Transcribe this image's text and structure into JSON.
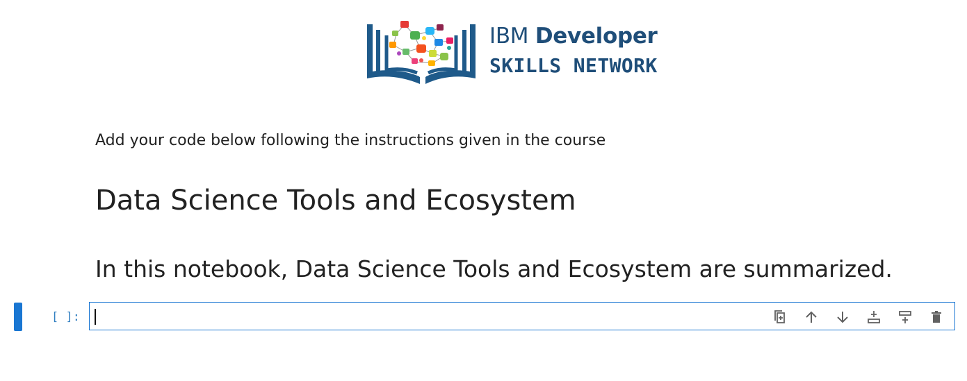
{
  "logo": {
    "line1_regular": "IBM",
    "line1_bold": "Developer",
    "line2": "SKILLS NETWORK",
    "brand_color": "#1f4e79"
  },
  "markdown": {
    "instruction": "Add your code below following the instructions given in the course",
    "heading1": "Data Science Tools and Ecosystem",
    "heading2": "In this notebook, Data Science Tools and Ecosystem are summarized."
  },
  "code_cell": {
    "prompt": "[ ]:",
    "value": "",
    "active_color": "#1976d2"
  },
  "cell_toolbar": {
    "icons": [
      "duplicate-icon",
      "move-up-icon",
      "move-down-icon",
      "insert-above-icon",
      "insert-below-icon",
      "delete-icon"
    ]
  }
}
